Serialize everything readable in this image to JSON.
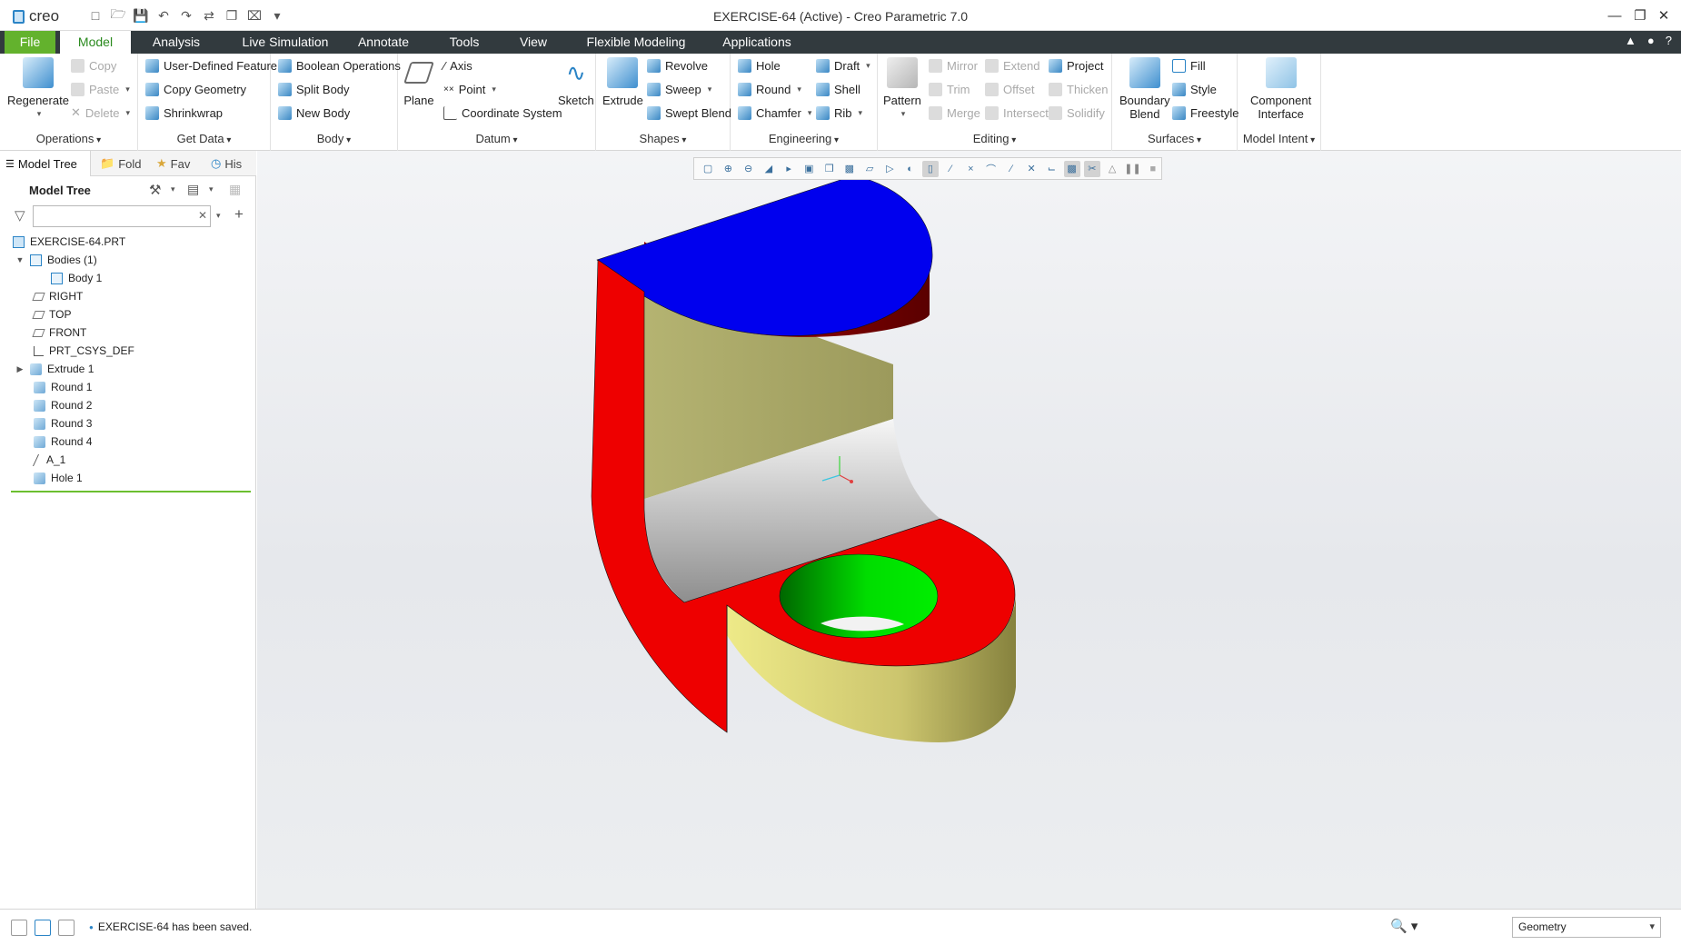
{
  "window": {
    "title": "EXERCISE-64 (Active) - Creo Parametric 7.0",
    "app_logo": "creo"
  },
  "window_controls": [
    "minimize-icon",
    "maximize-icon",
    "close-icon"
  ],
  "ribbon_tabs": [
    "File",
    "Model",
    "Analysis",
    "Live Simulation",
    "Annotate",
    "Tools",
    "View",
    "Flexible Modeling",
    "Applications"
  ],
  "active_tab": "Model",
  "groups": {
    "operations": {
      "label": "Operations",
      "regenerate": "Regenerate",
      "copy": "Copy",
      "paste": "Paste",
      "delete": "Delete"
    },
    "get_data": {
      "label": "Get Data",
      "udf": "User-Defined Feature",
      "copy_geometry": "Copy Geometry",
      "shrinkwrap": "Shrinkwrap"
    },
    "body": {
      "label": "Body",
      "boolean": "Boolean Operations",
      "split": "Split Body",
      "new": "New Body"
    },
    "datum": {
      "label": "Datum",
      "plane": "Plane",
      "axis": "Axis",
      "point": "Point",
      "csys": "Coordinate System",
      "sketch": "Sketch"
    },
    "shapes": {
      "label": "Shapes",
      "extrude": "Extrude",
      "revolve": "Revolve",
      "sweep": "Sweep",
      "swept_blend": "Swept Blend"
    },
    "engineering": {
      "label": "Engineering",
      "hole": "Hole",
      "round": "Round",
      "chamfer": "Chamfer",
      "draft": "Draft",
      "shell": "Shell",
      "rib": "Rib"
    },
    "editing": {
      "label": "Editing",
      "pattern": "Pattern",
      "mirror": "Mirror",
      "trim": "Trim",
      "merge": "Merge",
      "extend": "Extend",
      "offset": "Offset",
      "intersect": "Intersect",
      "project": "Project",
      "thicken": "Thicken",
      "solidify": "Solidify"
    },
    "surfaces": {
      "label": "Surfaces",
      "boundary_line1": "Boundary",
      "boundary_line2": "Blend",
      "fill": "Fill",
      "style": "Style",
      "freestyle": "Freestyle"
    },
    "model_intent": {
      "label": "Model Intent",
      "ci_line1": "Component",
      "ci_line2": "Interface"
    }
  },
  "nav_tabs": [
    "Model Tree",
    "Fold",
    "Fav",
    "His"
  ],
  "model_tree": {
    "title": "Model Tree",
    "search_placeholder": "",
    "items": [
      "EXERCISE-64.PRT",
      "Bodies (1)",
      "Body 1",
      "RIGHT",
      "TOP",
      "FRONT",
      "PRT_CSYS_DEF",
      "Extrude 1",
      "Round 1",
      "Round 2",
      "Round 3",
      "Round 4",
      "A_1",
      "Hole 1"
    ]
  },
  "status": {
    "message": "EXERCISE-64 has been saved.",
    "filter_value": "Geometry"
  },
  "colors": {
    "ribbon_dark": "#323a3e",
    "file_tab": "#63b22d",
    "model_red": "#ee0000",
    "model_blue": "#0000ee",
    "model_green": "#00dd00",
    "model_yellow": "#e8e07a"
  }
}
